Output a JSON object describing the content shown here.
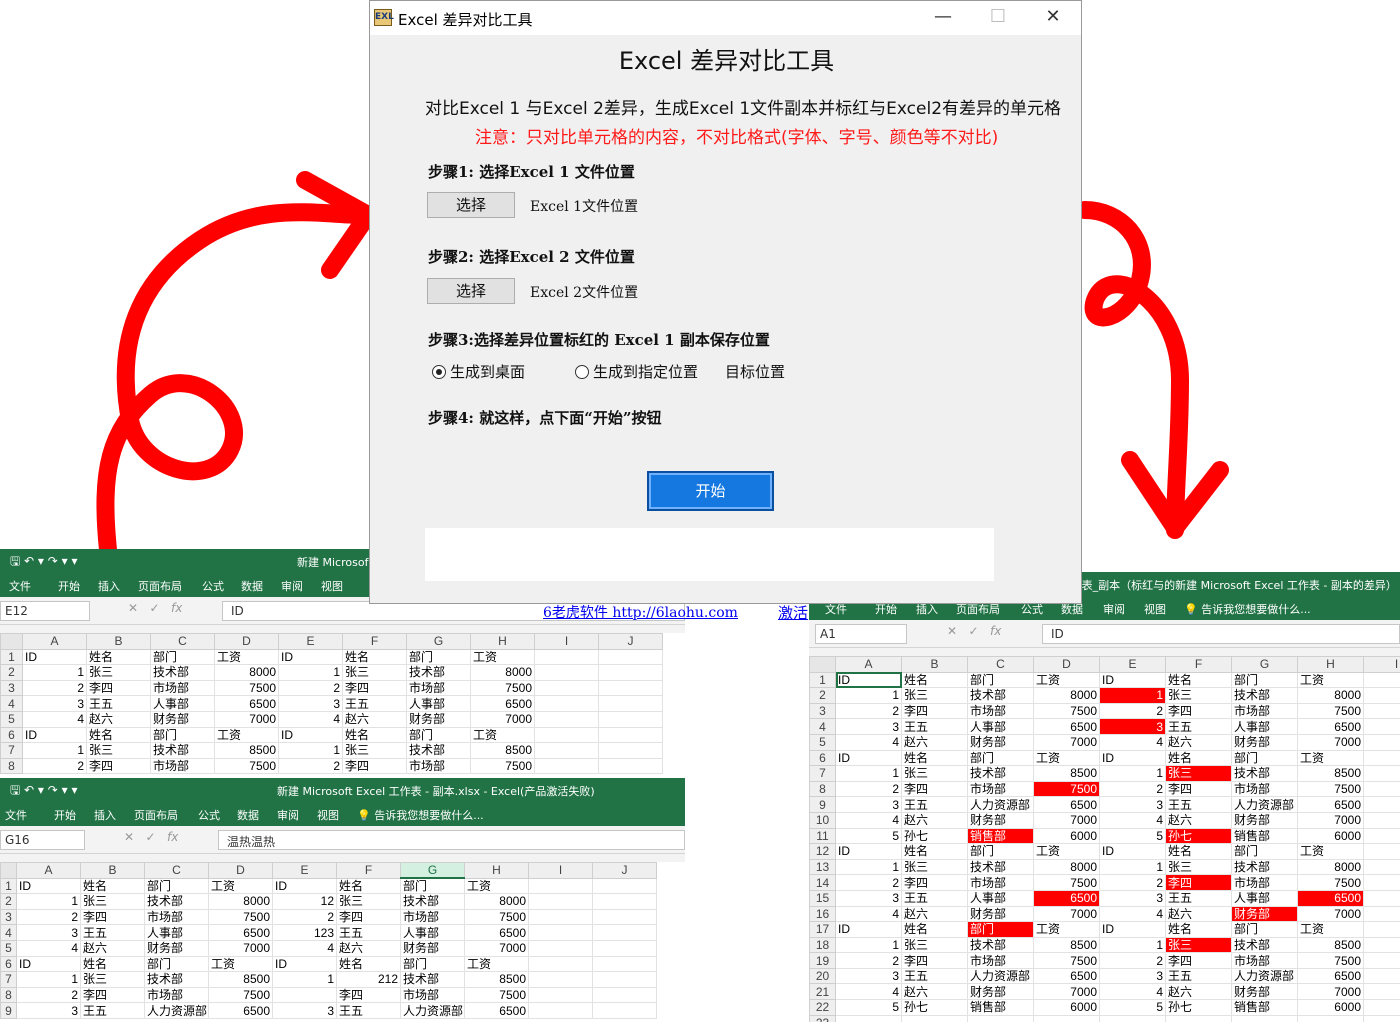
{
  "dialog": {
    "window_title": "Excel 差异对比工具",
    "icon_label": "EXL",
    "app_title": "Excel 差异对比工具",
    "description": "对比Excel 1 与Excel 2差异，生成Excel 1文件副本并标红与Excel2有差异的单元格",
    "note": "注意：只对比单元格的内容，不对比格式(字体、字号、颜色等不对比)",
    "step1_title": "步骤1: 选择Excel 1 文件位置",
    "step1_button": "选择",
    "step1_label": "Excel 1文件位置",
    "step2_title": "步骤2: 选择Excel 2 文件位置",
    "step2_button": "选择",
    "step2_label": "Excel 2文件位置",
    "step3_title": "步骤3:选择差异位置标红的 Excel 1 副本保存位置",
    "radio_desktop": "生成到桌面",
    "radio_custom": "生成到指定位置",
    "target_label": "目标位置",
    "step4_title": "步骤4: 就这样，点下面“开始”按钮",
    "start_button": "开始",
    "link_site": "6老虎软件 http://6laohu.com",
    "link_activate": "激活"
  },
  "excel_left_top": {
    "quick_access": "🖫 ↶ ▾ ↷ ▾ ▾",
    "title": "新建 Microsof",
    "ribbon": [
      "文件",
      "开始",
      "插入",
      "页面布局",
      "公式",
      "数据",
      "审阅",
      "视图"
    ],
    "namebox": "E12",
    "formula": "ID",
    "columns": [
      "A",
      "B",
      "C",
      "D",
      "E",
      "F",
      "G",
      "H",
      "I",
      "J"
    ],
    "rows": [
      [
        "1",
        "ID",
        "姓名",
        "部门",
        "工资",
        "ID",
        "姓名",
        "部门",
        "工资",
        "",
        ""
      ],
      [
        "2",
        "1",
        "张三",
        "技术部",
        "8000",
        "1",
        "张三",
        "技术部",
        "8000",
        "",
        ""
      ],
      [
        "3",
        "2",
        "李四",
        "市场部",
        "7500",
        "2",
        "李四",
        "市场部",
        "7500",
        "",
        ""
      ],
      [
        "4",
        "3",
        "王五",
        "人事部",
        "6500",
        "3",
        "王五",
        "人事部",
        "6500",
        "",
        ""
      ],
      [
        "5",
        "4",
        "赵六",
        "财务部",
        "7000",
        "4",
        "赵六",
        "财务部",
        "7000",
        "",
        ""
      ],
      [
        "6",
        "ID",
        "姓名",
        "部门",
        "工资",
        "ID",
        "姓名",
        "部门",
        "工资",
        "",
        ""
      ],
      [
        "7",
        "1",
        "张三",
        "技术部",
        "8500",
        "1",
        "张三",
        "技术部",
        "8500",
        "",
        ""
      ],
      [
        "8",
        "2",
        "李四",
        "市场部",
        "7500",
        "2",
        "李四",
        "市场部",
        "7500",
        "",
        ""
      ]
    ]
  },
  "excel_left_bottom": {
    "quick_access": "🖫 ↶ ▾ ↷ ▾ ▾",
    "title": "新建 Microsoft Excel 工作表 - 副本.xlsx - Excel(产品激活失败)",
    "ribbon": [
      "文件",
      "开始",
      "插入",
      "页面布局",
      "公式",
      "数据",
      "审阅",
      "视图"
    ],
    "tell_me": "告诉我您想要做什么...",
    "namebox": "G16",
    "formula": "温热温热",
    "columns": [
      "A",
      "B",
      "C",
      "D",
      "E",
      "F",
      "G",
      "H",
      "I",
      "J"
    ],
    "rows": [
      [
        "1",
        "ID",
        "姓名",
        "部门",
        "工资",
        "ID",
        "姓名",
        "部门",
        "工资",
        "",
        ""
      ],
      [
        "2",
        "1",
        "张三",
        "技术部",
        "8000",
        "12",
        "张三",
        "技术部",
        "8000",
        "",
        ""
      ],
      [
        "3",
        "2",
        "李四",
        "市场部",
        "7500",
        "2",
        "李四",
        "市场部",
        "7500",
        "",
        ""
      ],
      [
        "4",
        "3",
        "王五",
        "人事部",
        "6500",
        "123",
        "王五",
        "人事部",
        "6500",
        "",
        ""
      ],
      [
        "5",
        "4",
        "赵六",
        "财务部",
        "7000",
        "4",
        "赵六",
        "财务部",
        "7000",
        "",
        ""
      ],
      [
        "6",
        "ID",
        "姓名",
        "部门",
        "工资",
        "ID",
        "姓名",
        "部门",
        "工资",
        "",
        ""
      ],
      [
        "7",
        "1",
        "张三",
        "技术部",
        "8500",
        "1",
        "212",
        "技术部",
        "8500",
        "",
        ""
      ],
      [
        "8",
        "2",
        "李四",
        "市场部",
        "7500",
        "",
        "李四",
        "市场部",
        "7500",
        "",
        ""
      ],
      [
        "9",
        "3",
        "王五",
        "人力资源部",
        "6500",
        "3",
        "王五",
        "人力资源部",
        "6500",
        "",
        ""
      ]
    ]
  },
  "excel_right": {
    "quick_access": "🖫 ↶ ▾ ↷ ▾ ▾",
    "title": "新建 Microsoft Excel 工作表_副本（标红与的新建 Microsoft Excel 工作表 - 副本的差异）",
    "ribbon": [
      "文件",
      "开始",
      "插入",
      "页面布局",
      "公式",
      "数据",
      "审阅",
      "视图"
    ],
    "tell_me": "告诉我您想要做什么...",
    "namebox": "A1",
    "formula": "ID",
    "columns": [
      "A",
      "B",
      "C",
      "D",
      "E",
      "F",
      "G",
      "H",
      "I"
    ],
    "rows": [
      [
        "1",
        "ID",
        "姓名",
        "部门",
        "工资",
        "ID",
        "姓名",
        "部门",
        "工资",
        ""
      ],
      [
        "2",
        "1",
        "张三",
        "技术部",
        "8000",
        "1",
        "张三",
        "技术部",
        "8000",
        ""
      ],
      [
        "3",
        "2",
        "李四",
        "市场部",
        "7500",
        "2",
        "李四",
        "市场部",
        "7500",
        ""
      ],
      [
        "4",
        "3",
        "王五",
        "人事部",
        "6500",
        "3",
        "王五",
        "人事部",
        "6500",
        ""
      ],
      [
        "5",
        "4",
        "赵六",
        "财务部",
        "7000",
        "4",
        "赵六",
        "财务部",
        "7000",
        ""
      ],
      [
        "6",
        "ID",
        "姓名",
        "部门",
        "工资",
        "ID",
        "姓名",
        "部门",
        "工资",
        ""
      ],
      [
        "7",
        "1",
        "张三",
        "技术部",
        "8500",
        "1",
        "张三",
        "技术部",
        "8500",
        ""
      ],
      [
        "8",
        "2",
        "李四",
        "市场部",
        "7500",
        "2",
        "李四",
        "市场部",
        "7500",
        ""
      ],
      [
        "9",
        "3",
        "王五",
        "人力资源部",
        "6500",
        "3",
        "王五",
        "人力资源部",
        "6500",
        ""
      ],
      [
        "10",
        "4",
        "赵六",
        "财务部",
        "7000",
        "4",
        "赵六",
        "财务部",
        "7000",
        ""
      ],
      [
        "11",
        "5",
        "孙七",
        "销售部",
        "6000",
        "5",
        "孙七",
        "销售部",
        "6000",
        ""
      ],
      [
        "12",
        "ID",
        "姓名",
        "部门",
        "工资",
        "ID",
        "姓名",
        "部门",
        "工资",
        ""
      ],
      [
        "13",
        "1",
        "张三",
        "技术部",
        "8000",
        "1",
        "张三",
        "技术部",
        "8000",
        ""
      ],
      [
        "14",
        "2",
        "李四",
        "市场部",
        "7500",
        "2",
        "李四",
        "市场部",
        "7500",
        ""
      ],
      [
        "15",
        "3",
        "王五",
        "人事部",
        "6500",
        "3",
        "王五",
        "人事部",
        "6500",
        ""
      ],
      [
        "16",
        "4",
        "赵六",
        "财务部",
        "7000",
        "4",
        "赵六",
        "财务部",
        "7000",
        ""
      ],
      [
        "17",
        "ID",
        "姓名",
        "部门",
        "工资",
        "ID",
        "姓名",
        "部门",
        "工资",
        ""
      ],
      [
        "18",
        "1",
        "张三",
        "技术部",
        "8500",
        "1",
        "张三",
        "技术部",
        "8500",
        ""
      ],
      [
        "19",
        "2",
        "李四",
        "市场部",
        "7500",
        "2",
        "李四",
        "市场部",
        "7500",
        ""
      ],
      [
        "20",
        "3",
        "王五",
        "人力资源部",
        "6500",
        "3",
        "王五",
        "人力资源部",
        "6500",
        ""
      ],
      [
        "21",
        "4",
        "赵六",
        "财务部",
        "7000",
        "4",
        "赵六",
        "财务部",
        "7000",
        ""
      ],
      [
        "22",
        "5",
        "孙七",
        "销售部",
        "6000",
        "5",
        "孙七",
        "销售部",
        "6000",
        ""
      ],
      [
        "23",
        "",
        "",
        "",
        "",
        "",
        "",
        "",
        "",
        ""
      ]
    ],
    "highlight_cells": [
      "E2",
      "E4",
      "C11",
      "D15",
      "C17",
      "D8",
      "F7",
      "F11",
      "F14",
      "F18",
      "G16",
      "H15"
    ]
  },
  "colors": {
    "excel_green": "#217346",
    "diff_red": "#ff0000",
    "start_blue": "#1478e0",
    "arrow_red": "#ff0000"
  }
}
